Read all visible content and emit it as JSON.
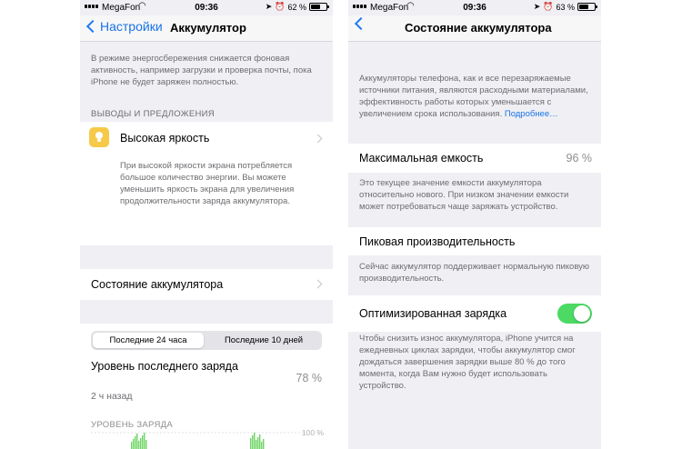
{
  "left": {
    "status": {
      "carrier": "MegaFon",
      "time": "09:36",
      "battery": "62 %",
      "battery_level": 0.62
    },
    "nav": {
      "back_label": "Настройки",
      "title": "Аккумулятор"
    },
    "top_desc": "В режиме энергосбережения снижается фоновая активность, например загрузки и проверка почты, пока iPhone не будет заряжен полностью.",
    "insights_header": "ВЫВОДЫ И ПРЕДЛОЖЕНИЯ",
    "brightness": {
      "title": "Высокая яркость",
      "desc": "При высокой яркости экрана потребляется большое количество энергии. Вы можете уменьшить яркость экрана для увеличения продолжительности заряда аккумулятора."
    },
    "health_label": "Состояние аккумулятора",
    "segments": [
      "Последние 24 часа",
      "Последние 10 дней"
    ],
    "last_charge": {
      "title": "Уровень последнего заряда",
      "value": "78 %",
      "time": "2 ч назад"
    },
    "charge_level_header": "УРОВЕНЬ ЗАРЯДА",
    "chart_axis_label": "100 %"
  },
  "right": {
    "status": {
      "carrier": "MegaFon",
      "time": "09:36",
      "battery": "63 %",
      "battery_level": 0.63
    },
    "nav": {
      "title": "Состояние аккумулятора"
    },
    "intro": "Аккумуляторы телефона, как и все перезаряжаемые источники питания, являются расходными материалами, эффективность работы которых уменьшается с увеличением срока использования.",
    "more_link": "Подробнее…",
    "max_capacity": {
      "label": "Максимальная емкость",
      "value": "96 %",
      "desc": "Это текущее значение емкости аккумулятора относительно нового. При низком значении емкости может потребоваться чаще заряжать устройство."
    },
    "peak": {
      "label": "Пиковая производительность",
      "desc": "Сейчас аккумулятор поддерживает нормальную пиковую производительность."
    },
    "optimized": {
      "label": "Оптимизированная зарядка",
      "enabled": true,
      "desc": "Чтобы снизить износ аккумулятора, iPhone учится на ежедневных циклах зарядки, чтобы аккумулятор смог дождаться завершения зарядки выше 80 % до того момента, когда Вам нужно будет использовать устройство."
    }
  },
  "colors": {
    "accent": "#1a73e8",
    "toggle_on": "#4cd964",
    "chart_fill": "#6cd463",
    "bulb": "#f7c948"
  }
}
